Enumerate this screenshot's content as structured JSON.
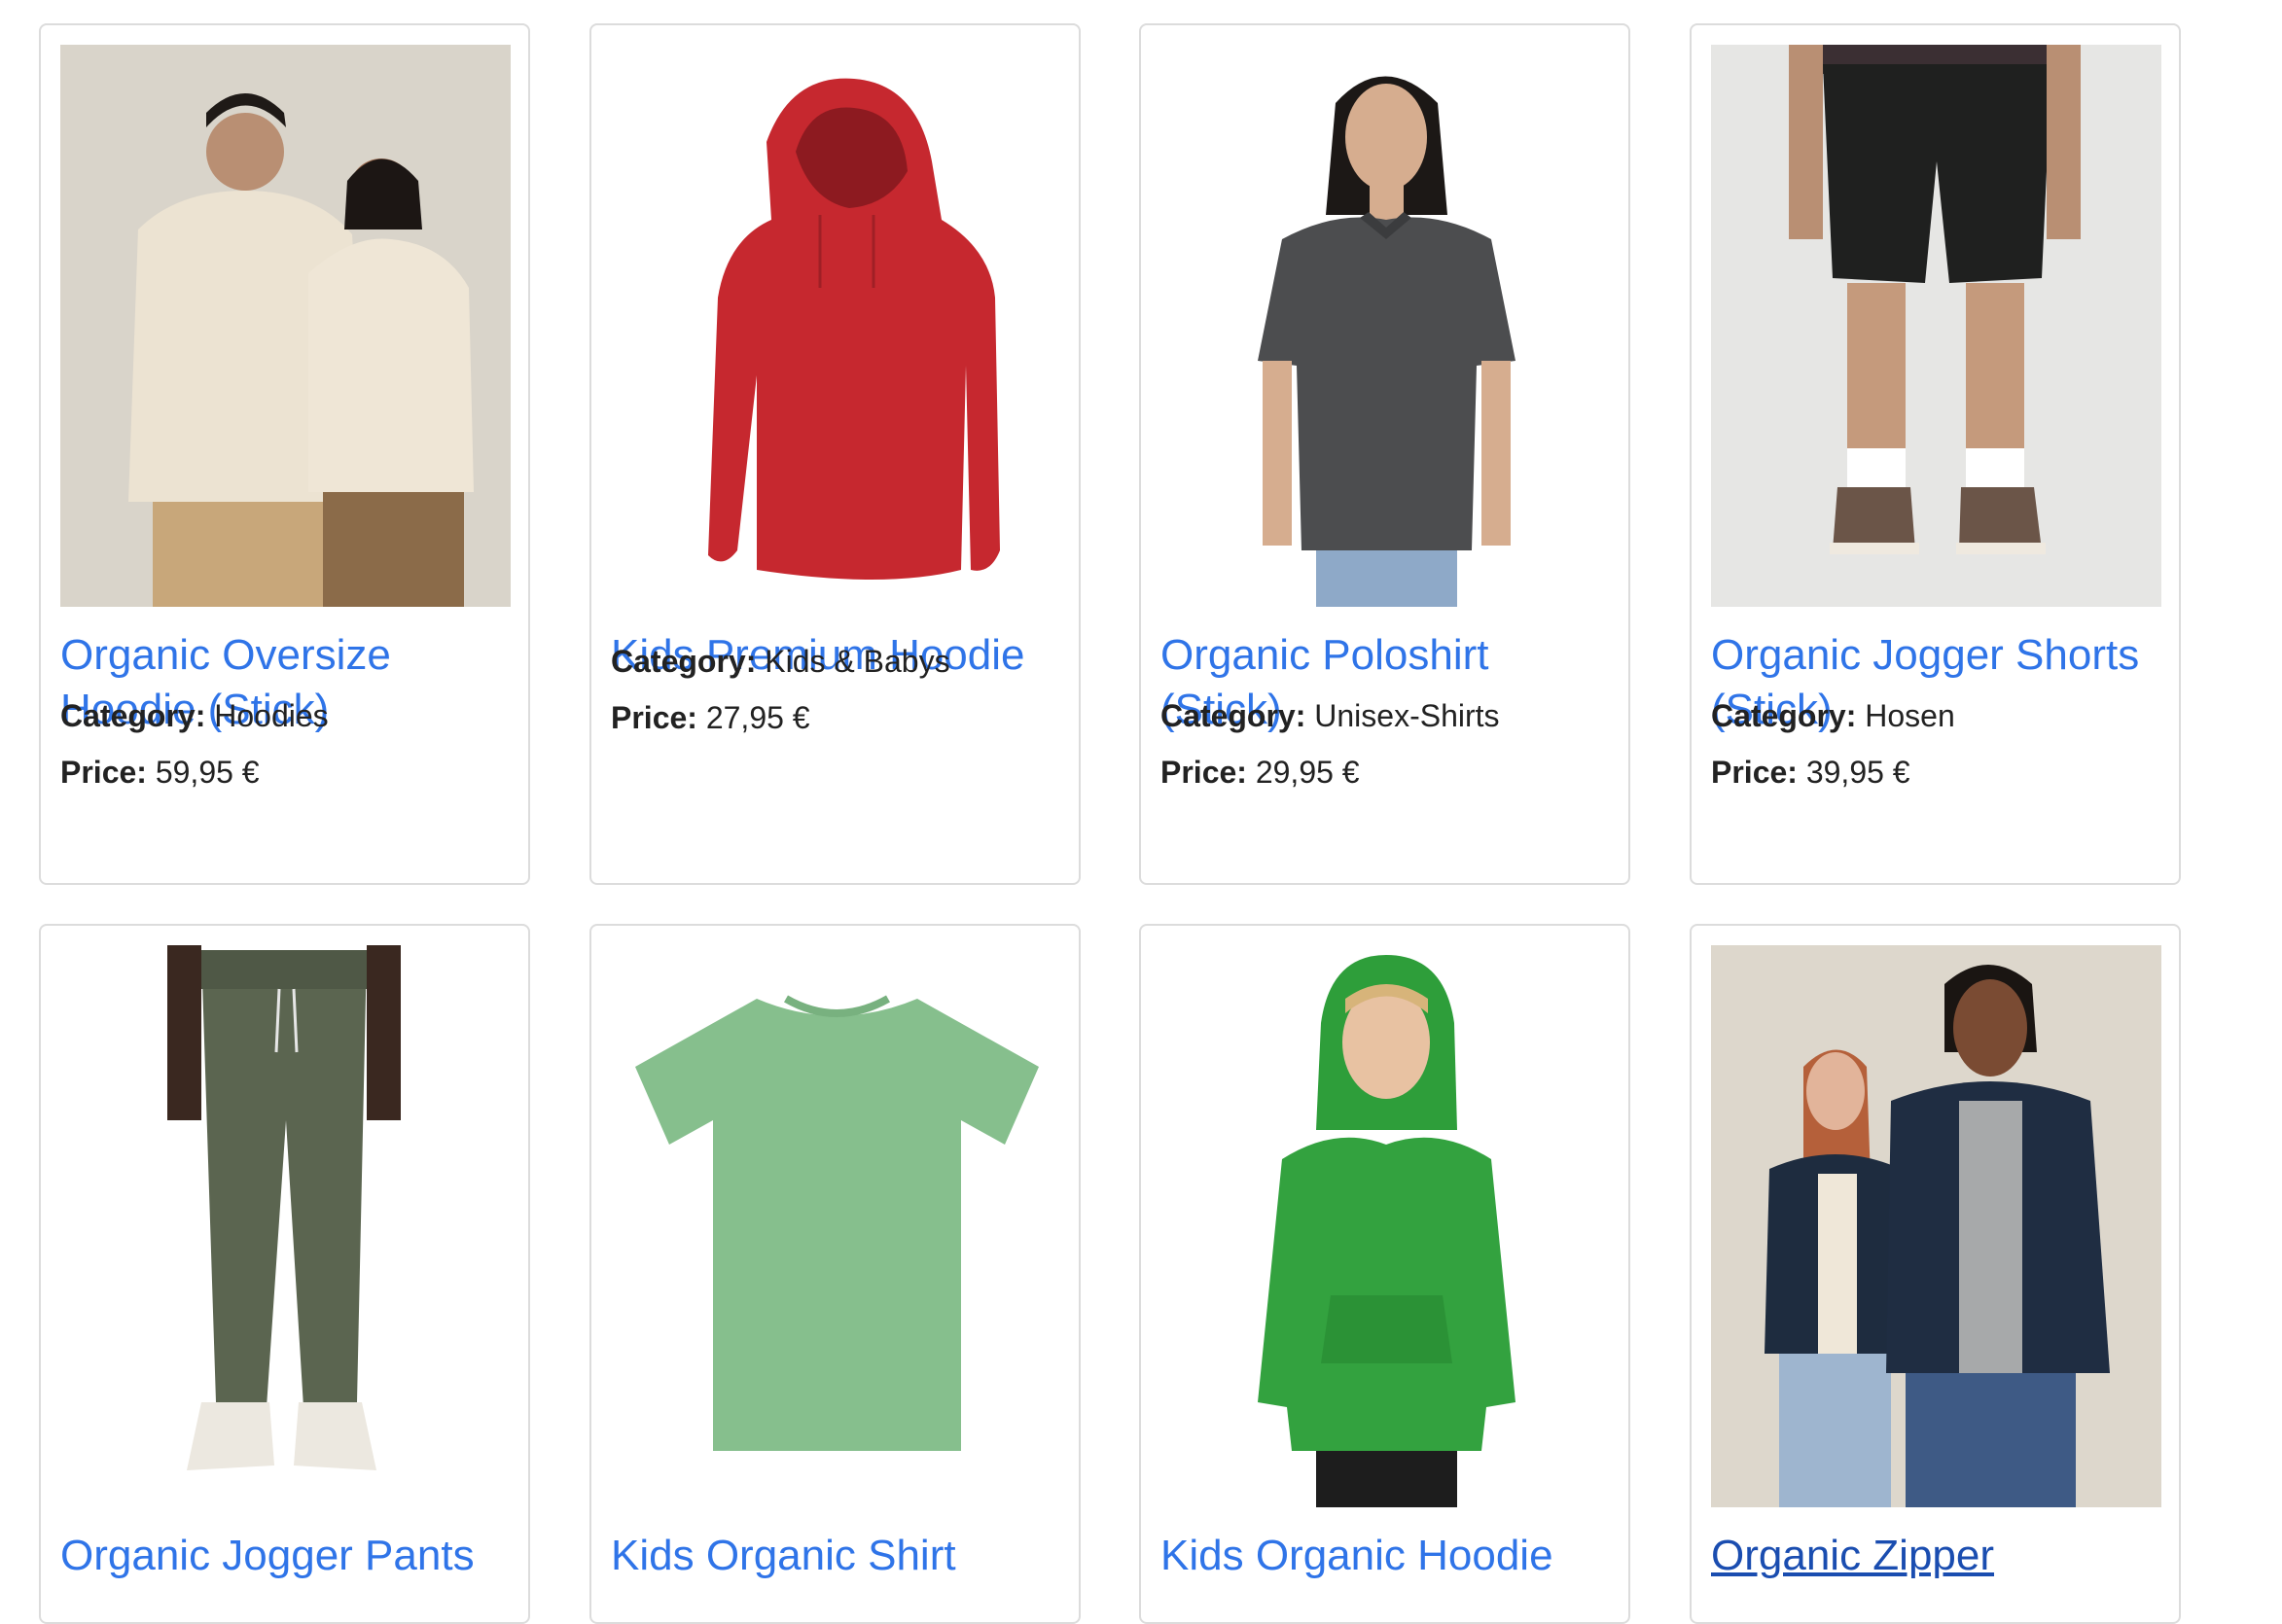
{
  "labels": {
    "category": "Category:",
    "price": "Price:"
  },
  "colors": {
    "link": "#2f74e8",
    "link_hover": "#1a4db0",
    "card_border": "#dcdcdc",
    "text": "#222222"
  },
  "products": [
    {
      "name": "Organic Oversize Hoodie (Stick)",
      "category": "Hoodies",
      "price": "59,95 €"
    },
    {
      "name": "Kids Premium Hoodie",
      "category": "Kids & Babys",
      "price": "27,95 €"
    },
    {
      "name": "Organic Poloshirt (Stick)",
      "category": "Unisex-Shirts",
      "price": "29,95 €"
    },
    {
      "name": "Organic Jogger Shorts (Stick)",
      "category": "Hosen",
      "price": "39,95 €"
    },
    {
      "name": "Organic Jogger Pants"
    },
    {
      "name": "Kids Organic Shirt"
    },
    {
      "name": "Kids Organic Hoodie"
    },
    {
      "name": "Organic Zipper"
    }
  ]
}
